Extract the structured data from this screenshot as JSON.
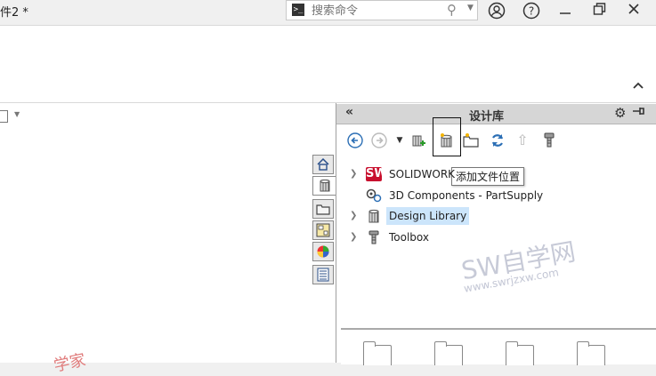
{
  "titlebar": {
    "doc_title": "件2 *",
    "search_placeholder": "搜索命令",
    "cmd_glyph": ">_",
    "search_icon": "search-icon",
    "window_buttons": [
      "help-circle-icon",
      "help-icon",
      "minimize-icon",
      "restore-icon",
      "close-icon"
    ]
  },
  "panel": {
    "title": "设计库",
    "collapse_glyph": "«",
    "tooltip": "添加文件位置",
    "toolbar_icons": [
      "back-icon",
      "forward-icon",
      "dropdown-arrow-icon",
      "add-to-library-icon",
      "add-file-location-icon",
      "create-new-folder-icon",
      "refresh-icon",
      "up-one-level-icon",
      "toolbox-icon"
    ]
  },
  "tree": [
    {
      "label": "SOLIDWORK",
      "icon": "solidworks-content-icon",
      "expandable": true
    },
    {
      "label": "3D Components - PartSupply",
      "icon": "3d-components-icon",
      "expandable": false
    },
    {
      "label": "Design Library",
      "icon": "design-library-icon",
      "expandable": true,
      "selected": true
    },
    {
      "label": "Toolbox",
      "icon": "toolbox-icon",
      "expandable": true
    }
  ],
  "tabs": [
    "home-icon",
    "design-library-tab-icon",
    "file-explorer-icon",
    "view-palette-icon",
    "appearances-icon",
    "custom-properties-icon"
  ],
  "watermark": {
    "main": "SW自学网",
    "sub": "www.swrjzxw.com",
    "red_fragment": "学家"
  }
}
